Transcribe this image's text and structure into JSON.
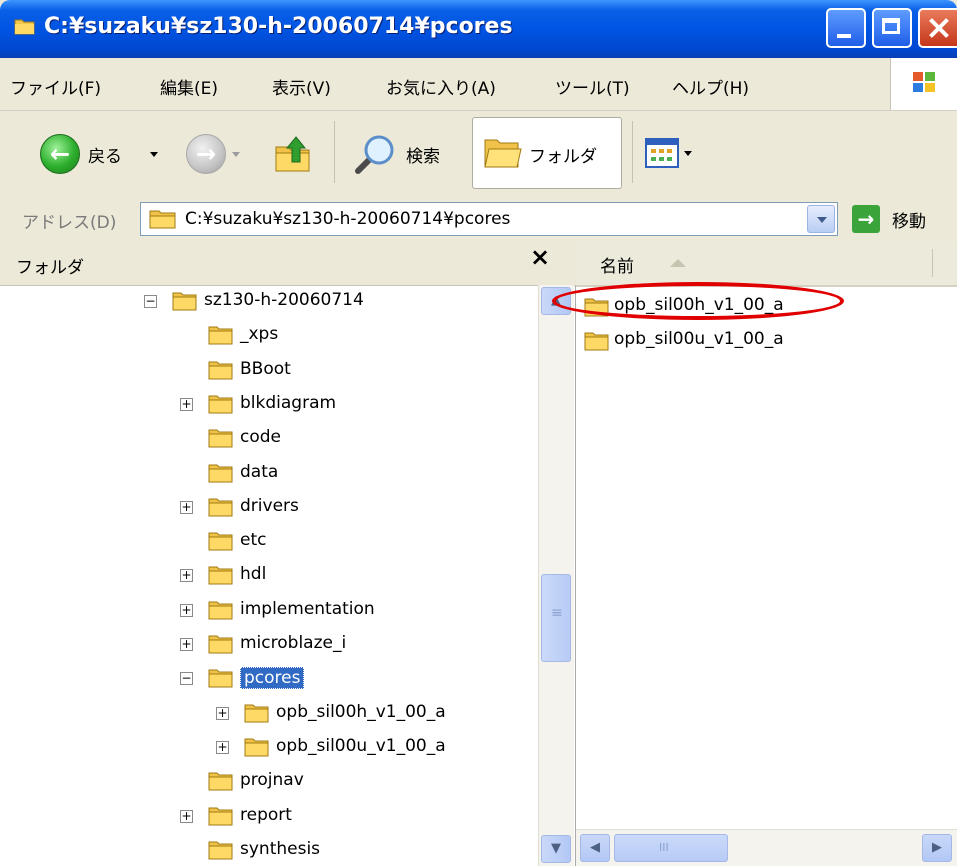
{
  "window": {
    "title": "C:¥suzaku¥sz130-h-20060714¥pcores"
  },
  "menu": [
    "ファイル(F)",
    "編集(E)",
    "表示(V)",
    "お気に入り(A)",
    "ツール(T)",
    "ヘルプ(H)"
  ],
  "toolbar": {
    "back_label": "戻る",
    "search_label": "検索",
    "folders_label": "フォルダ"
  },
  "address": {
    "label": "アドレス(D)",
    "value": "C:¥suzaku¥sz130-h-20060714¥pcores",
    "go_label": "移動"
  },
  "folders_pane": {
    "title": "フォルダ",
    "close": "×",
    "tree": [
      {
        "label": "sz130-h-20060714",
        "expander": "−"
      },
      {
        "label": "_xps",
        "expander": ""
      },
      {
        "label": "BBoot",
        "expander": ""
      },
      {
        "label": "blkdiagram",
        "expander": "+"
      },
      {
        "label": "code",
        "expander": ""
      },
      {
        "label": "data",
        "expander": ""
      },
      {
        "label": "drivers",
        "expander": "+"
      },
      {
        "label": "etc",
        "expander": ""
      },
      {
        "label": "hdl",
        "expander": "+"
      },
      {
        "label": "implementation",
        "expander": "+"
      },
      {
        "label": "microblaze_i",
        "expander": "+"
      },
      {
        "label": "pcores",
        "expander": "−",
        "selected": true
      },
      {
        "label": "opb_sil00h_v1_00_a",
        "expander": "+"
      },
      {
        "label": "opb_sil00u_v1_00_a",
        "expander": "+"
      },
      {
        "label": "projnav",
        "expander": ""
      },
      {
        "label": "report",
        "expander": "+"
      },
      {
        "label": "synthesis",
        "expander": ""
      }
    ]
  },
  "list_pane": {
    "column_name": "名前",
    "items": [
      "opb_sil00h_v1_00_a",
      "opb_sil00u_v1_00_a"
    ]
  },
  "scrollbar": {
    "up": "▲",
    "down": "▼",
    "left": "◀",
    "right": "▶",
    "grip": "≡",
    "hgrip": "III"
  }
}
